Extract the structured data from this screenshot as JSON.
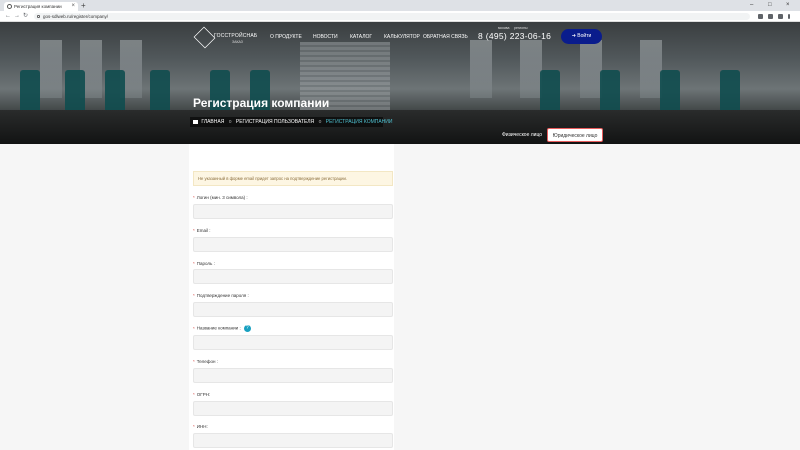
{
  "browser": {
    "tab_title": "Регистрация компании",
    "tab_close": "×",
    "new_tab": "+",
    "url": "gos-sdlweb.ru/register/company/",
    "nav": {
      "back": "←",
      "forward": "→",
      "reload": "↻"
    },
    "window": {
      "minimize": "–",
      "maximize": "□",
      "close": "×"
    }
  },
  "site": {
    "logo_text": "ГОССТРОЙСНАБ",
    "logo_sub": "ЗАКАЗ",
    "menu": [
      "О продукте",
      "Новости",
      "Каталог",
      "Калькулятор",
      "Обратная связь"
    ],
    "phone_caption_left": "москва",
    "phone_caption_right": "регионы",
    "phone": "8 (495) 223-06-16",
    "login_label": "Войти",
    "page_title": "Регистрация компании",
    "breadcrumbs": {
      "home": "ГЛАВНАЯ",
      "user_reg": "РЕГИСТРАЦИЯ ПОЛЬЗОВАТЕЛЯ",
      "current": "РЕГИСТРАЦИЯ КОМПАНИИ"
    },
    "person_tabs": {
      "individual": "Физическое лицо",
      "legal": "Юридическое лицо"
    }
  },
  "form": {
    "notice": "Не указанный в форме email придет запрос на подтверждение регистрации.",
    "required_mark": "*",
    "fields": [
      {
        "label": "Логин (мин. 3 символа) :"
      },
      {
        "label": "Email :"
      },
      {
        "label": "Пароль :"
      },
      {
        "label": "Подтверждение пароля :"
      },
      {
        "label": "Название компании :"
      },
      {
        "label": "Телефон :"
      },
      {
        "label": "ОГРН:"
      },
      {
        "label": "ИНН:"
      }
    ],
    "help_icon": "?"
  }
}
